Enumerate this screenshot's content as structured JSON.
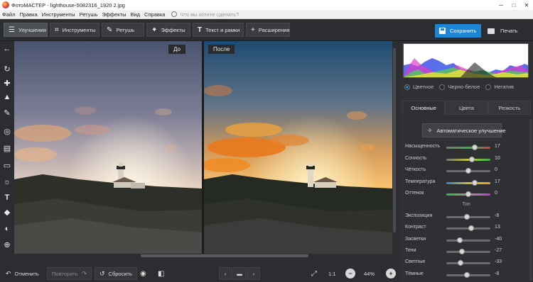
{
  "window": {
    "title": "ФотоМАСТЕР - lighthouse-5082316_1920 2.jpg"
  },
  "menu": {
    "items": [
      "Файл",
      "Правка",
      "Инструменты",
      "Ретушь",
      "Эффекты",
      "Вид",
      "Справка"
    ],
    "search_placeholder": "Что вы хотите сделать?"
  },
  "toolbar": {
    "tabs": [
      {
        "label": "Улучшения",
        "icon": "sliders-icon",
        "active": true
      },
      {
        "label": "Инструменты",
        "icon": "crop-icon"
      },
      {
        "label": "Ретушь",
        "icon": "brush-icon"
      },
      {
        "label": "Эффекты",
        "icon": "magic-wand-icon"
      },
      {
        "label": "Текст и рамки",
        "icon": "text-icon"
      },
      {
        "label": "Расширения",
        "icon": "plus-icon"
      }
    ],
    "save_label": "Сохранить",
    "print_label": "Печать"
  },
  "canvas": {
    "before_label": "До",
    "after_label": "После"
  },
  "bottom": {
    "undo": "Отменить",
    "redo": "Повторить",
    "reset": "Сбросить",
    "ratio": "1:1",
    "zoom": "44%"
  },
  "panel": {
    "modes": [
      "Цветное",
      "Черно-белое",
      "Негатив"
    ],
    "active_mode": "Цветное",
    "tabs": [
      "Основные",
      "Цвета",
      "Резкость"
    ],
    "auto_label": "Автоматическое улучшение",
    "sliders_top": [
      {
        "label": "Насыщенность",
        "value": "17",
        "level": 0.64
      },
      {
        "label": "Сочность",
        "value": "10",
        "level": 0.58
      },
      {
        "label": "Чёткость",
        "value": "0",
        "level": 0.5
      },
      {
        "label": "Температура",
        "value": "17",
        "level": 0.64
      },
      {
        "label": "Оттенок",
        "value": "0",
        "level": 0.5
      }
    ],
    "section_tone": "Тон",
    "sliders_tone": [
      {
        "label": "Экспозиция",
        "value": "-8",
        "level": 0.46
      },
      {
        "label": "Контраст",
        "value": "13",
        "level": 0.56
      },
      {
        "label": "Засветки",
        "value": "-40",
        "level": 0.3
      },
      {
        "label": "Тени",
        "value": "-27",
        "level": 0.36
      },
      {
        "label": "Светлые",
        "value": "-33",
        "level": 0.33
      },
      {
        "label": "Тёмные",
        "value": "-8",
        "level": 0.46
      }
    ]
  },
  "colors": {
    "accent": "#1c86d4",
    "background": "#2b2d30"
  }
}
